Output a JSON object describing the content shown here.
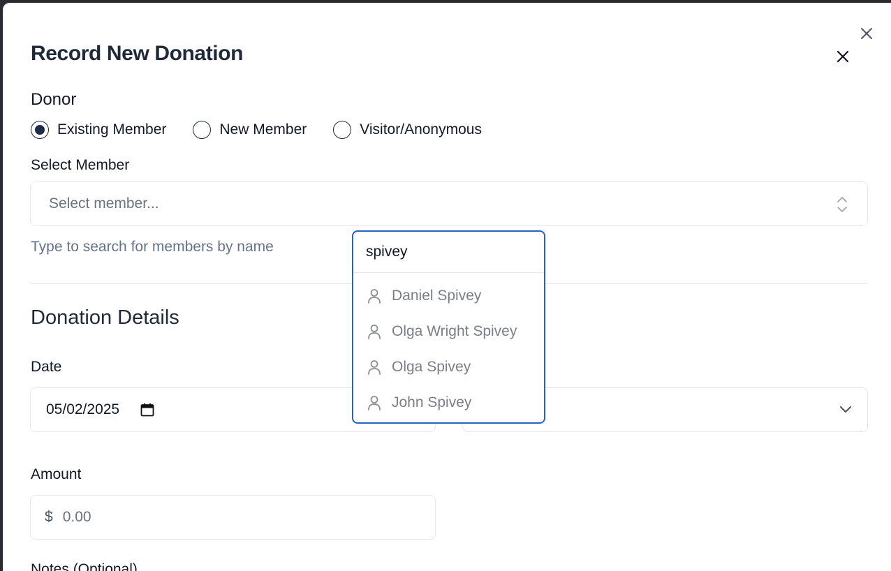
{
  "modal": {
    "title": "Record New Donation"
  },
  "donor": {
    "label": "Donor",
    "options": [
      {
        "label": "Existing Member",
        "selected": true
      },
      {
        "label": "New Member",
        "selected": false
      },
      {
        "label": "Visitor/Anonymous",
        "selected": false
      }
    ]
  },
  "member_select": {
    "label": "Select Member",
    "placeholder": "Select member...",
    "helper": "Type to search for members by name"
  },
  "member_search": {
    "query": "spivey",
    "results": [
      "Daniel Spivey",
      "Olga Wright Spivey",
      "Olga Spivey",
      "John Spivey"
    ]
  },
  "details": {
    "title": "Donation Details",
    "date_label": "Date",
    "date_value": "05/02/2025",
    "amount_label": "Amount",
    "currency_symbol": "$",
    "amount_placeholder": "0.00",
    "notes_label": "Notes (Optional)"
  },
  "icons": {
    "close": "close-icon",
    "chevron_updown": "chevron-up-down-icon",
    "chevron_down": "chevron-down-icon",
    "calendar": "calendar-icon",
    "user": "user-icon"
  },
  "colors": {
    "accent": "#2563c9",
    "radio_selected": "#1e2a4a",
    "muted_text": "#6b7280"
  }
}
